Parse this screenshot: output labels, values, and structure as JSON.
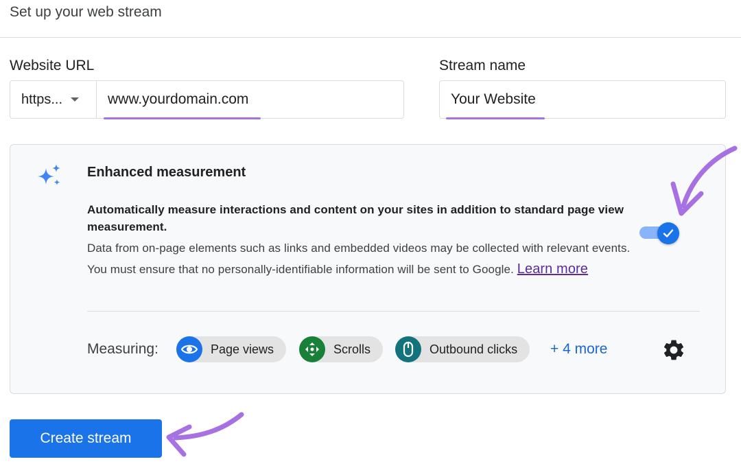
{
  "page": {
    "title": "Set up your web stream"
  },
  "form": {
    "url_label": "Website URL",
    "protocol": "https...",
    "url_value": "www.yourdomain.com",
    "name_label": "Stream name",
    "name_value": "Your Website"
  },
  "enhanced": {
    "title": "Enhanced measurement",
    "bold_text": "Automatically measure interactions and content on your sites in addition to standard page view measurement.",
    "description": "Data from on-page elements such as links and embedded videos may be collected with relevant events. You must ensure that no personally-identifiable information will be sent to Google.",
    "learn_more": "Learn more",
    "toggle_on": true,
    "measuring_label": "Measuring:",
    "chips": [
      {
        "label": "Page views",
        "icon": "eye-icon",
        "color": "#1a73e8"
      },
      {
        "label": "Scrolls",
        "icon": "scroll-icon",
        "color": "#188038"
      },
      {
        "label": "Outbound clicks",
        "icon": "mouse-icon",
        "color": "#12737d"
      }
    ],
    "more_link": "+ 4 more"
  },
  "actions": {
    "create_label": "Create stream"
  },
  "colors": {
    "accent": "#1a73e8",
    "highlight": "#a771e2"
  }
}
